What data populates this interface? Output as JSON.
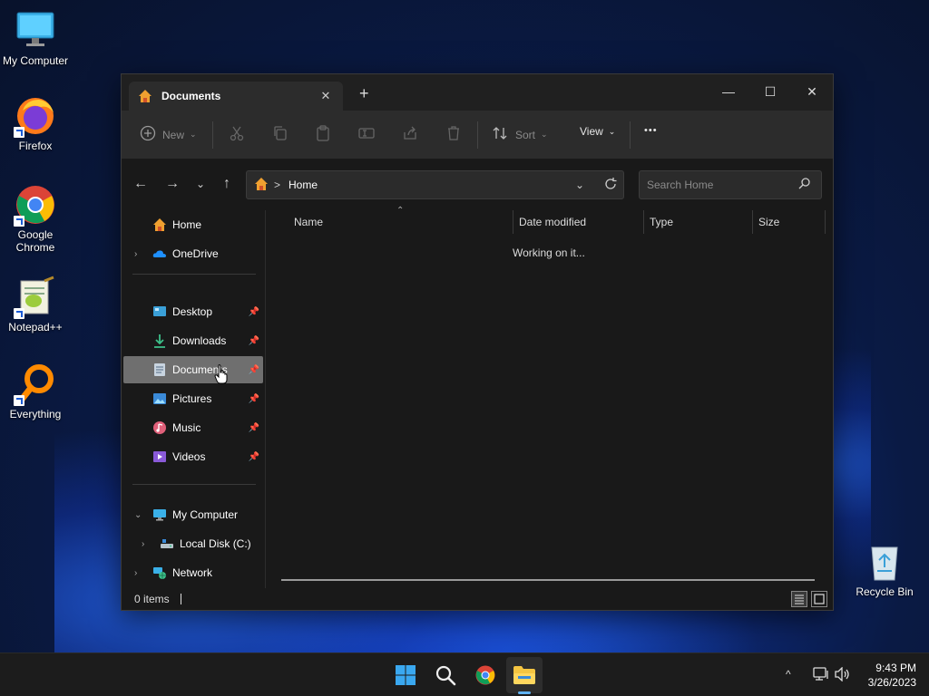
{
  "desktop": {
    "icons": [
      {
        "label": "My Computer"
      },
      {
        "label": "Firefox"
      },
      {
        "label": "Google Chrome"
      },
      {
        "label": "Notepad++"
      },
      {
        "label": "Everything"
      },
      {
        "label": "Recycle Bin"
      }
    ]
  },
  "explorer": {
    "tab_title": "Documents",
    "tab_close": "✕",
    "new_tab": "+",
    "window_buttons": {
      "minimize": "—",
      "maximize": "☐",
      "close": "✕"
    },
    "toolbar": {
      "new_label": "New",
      "sort_label": "Sort",
      "view_label": "View",
      "more_label": "•••"
    },
    "address": {
      "root": "Home",
      "separator": ">"
    },
    "search": {
      "placeholder": "Search Home"
    },
    "nav": {
      "home": "Home",
      "onedrive": "OneDrive",
      "desktop": "Desktop",
      "downloads": "Downloads",
      "documents": "Documents",
      "pictures": "Pictures",
      "music": "Music",
      "videos": "Videos",
      "my_computer": "My Computer",
      "local_disk": "Local Disk (C:)",
      "network": "Network"
    },
    "columns": {
      "name": "Name",
      "date_modified": "Date modified",
      "type": "Type",
      "size": "Size"
    },
    "status_message": "Working on it...",
    "item_count": "0 items"
  },
  "taskbar": {
    "time": "9:43 PM",
    "date": "3/26/2023",
    "overflow": "^"
  },
  "colors": {
    "accent": "#5fb2f2",
    "selected_nav": "#6f6f6f",
    "window_bg": "#191919",
    "toolbar_bg": "#2c2c2c"
  }
}
